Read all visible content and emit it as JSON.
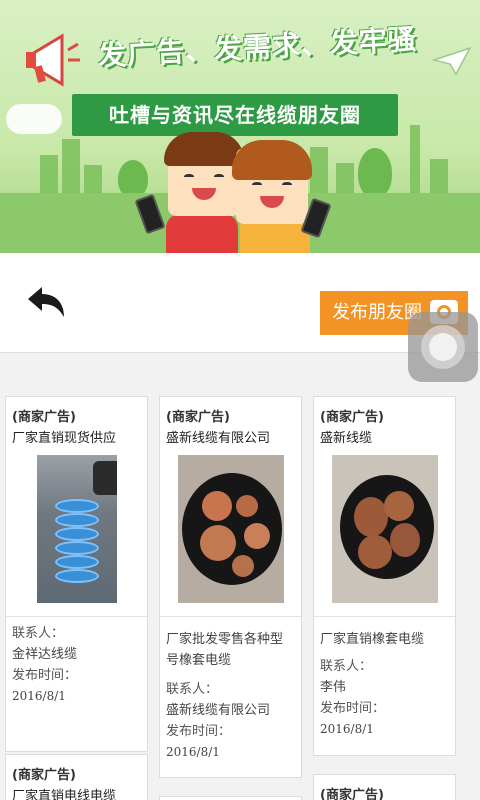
{
  "banner": {
    "headline": "发广告、发需求、发牢骚",
    "ribbon": "吐槽与资讯尽在线缆朋友圈"
  },
  "toolbar": {
    "post_label": "发布朋友圈"
  },
  "colors": {
    "accent": "#f39324",
    "ribbon": "#2e9a44",
    "banner_bg": "#c8e8a8"
  },
  "cards": [
    {
      "tag": "(商家广告)",
      "name": "厂家直销现货供应",
      "desc": "",
      "contact_label": "联系人：",
      "contact": "金祥达线缆",
      "time_label": "发布时间：",
      "date": "2016/8/1"
    },
    {
      "tag": "(商家广告)",
      "name": "盛新线缆有限公司",
      "desc": "厂家批发零售各种型号橡套电缆",
      "contact_label": "联系人：",
      "contact": "盛新线缆有限公司",
      "time_label": "发布时间：",
      "date": "2016/8/1"
    },
    {
      "tag": "(商家广告)",
      "name": "盛新线缆",
      "desc": "厂家直销橡套电缆",
      "contact_label": "联系人：",
      "contact": "李伟",
      "time_label": "发布时间：",
      "date": "2016/8/1"
    },
    {
      "tag": "(商家广告)",
      "name": "厂家直销电线电缆"
    },
    {
      "tag": "(商家广告)"
    }
  ]
}
